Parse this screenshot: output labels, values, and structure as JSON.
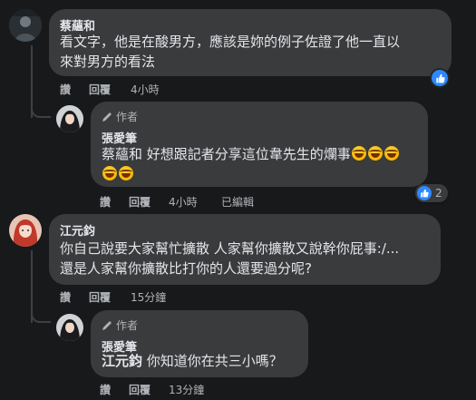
{
  "comments": [
    {
      "author": "蔡蘊和",
      "text_line1": "看文字，他是在酸男方，應該是妳的例子佐證了他一直以",
      "text_line2": "來對男方的看法",
      "actions": {
        "like": "讚",
        "reply": "回覆",
        "time": "4小時"
      }
    },
    {
      "badge": "作者",
      "author": "張愛筆",
      "mention": "蔡蘊和",
      "text_line1_rest": " 好想跟記者分享這位韋先生的爛事",
      "actions": {
        "like": "讚",
        "reply": "回覆",
        "time": "4小時",
        "edited": "已編輯"
      },
      "reaction_count": "2"
    },
    {
      "author": "江元鈞",
      "text_line1": "你自己說要大家幫忙擴散 人家幫你擴散又說幹你屁事:/...",
      "text_line2": "還是人家幫你擴散比打你的人還要過分呢?",
      "actions": {
        "like": "讚",
        "reply": "回覆",
        "time": "15分鐘"
      }
    },
    {
      "badge": "作者",
      "author": "張愛筆",
      "mention": "江元鈞",
      "text_rest": " 你知道你在共三小嗎？",
      "actions": {
        "like": "讚",
        "reply": "回覆",
        "time": "13分鐘"
      }
    }
  ],
  "icons": {
    "like": "thumbs-up-icon",
    "author_badge": "pencil-icon",
    "emoji": "rolling-on-floor-laughing-emoji"
  },
  "colors": {
    "background": "#18191a",
    "bubble": "#3a3b3c",
    "like_blue": "#2d88ff"
  }
}
